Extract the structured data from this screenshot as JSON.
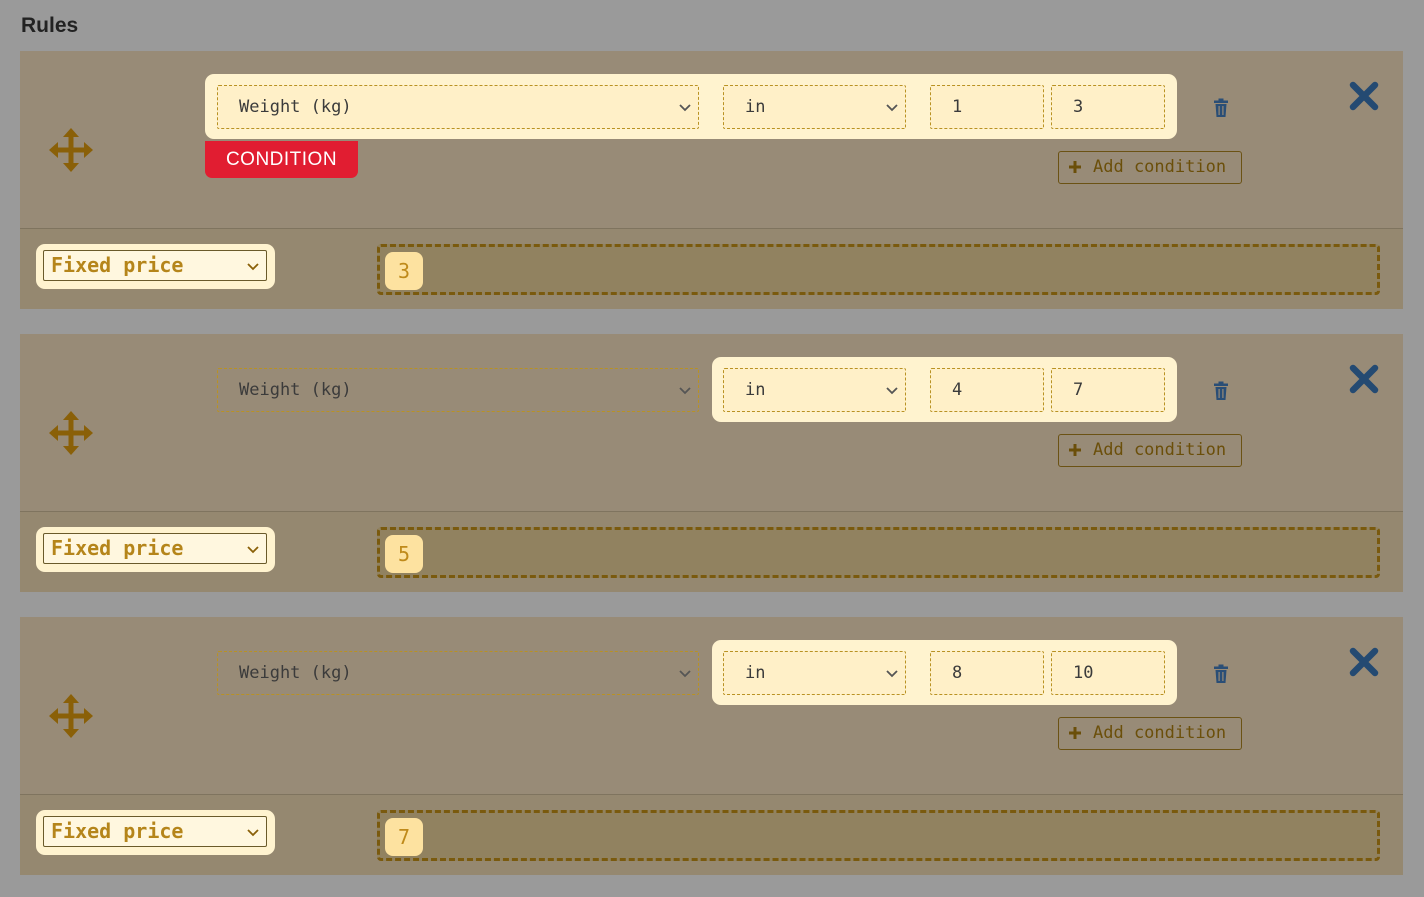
{
  "heading": "Rules",
  "colors": {
    "accent": "#8a6008",
    "icon_blue": "#2a4e76",
    "tag_red": "#e11d31",
    "highlight": "#fff3cf"
  },
  "icons": {
    "move": "move-icon",
    "trash": "trash-icon",
    "close": "close-icon",
    "chevron": "chevron-down-icon",
    "plus": "plus-icon"
  },
  "rules": [
    {
      "field": "Weight (kg)",
      "operator": "in",
      "from": "1",
      "to": "3",
      "highlighted_group": "all",
      "tag": "CONDITION",
      "add_condition_label": "Add condition",
      "price_type": "Fixed price",
      "price_value": "3"
    },
    {
      "field": "Weight (kg)",
      "operator": "in",
      "from": "4",
      "to": "7",
      "highlighted_group": "operator-and-values",
      "add_condition_label": "Add condition",
      "price_type": "Fixed price",
      "price_value": "5"
    },
    {
      "field": "Weight (kg)",
      "operator": "in",
      "from": "8",
      "to": "10",
      "highlighted_group": "operator-and-values",
      "add_condition_label": "Add condition",
      "price_type": "Fixed price",
      "price_value": "7"
    }
  ]
}
